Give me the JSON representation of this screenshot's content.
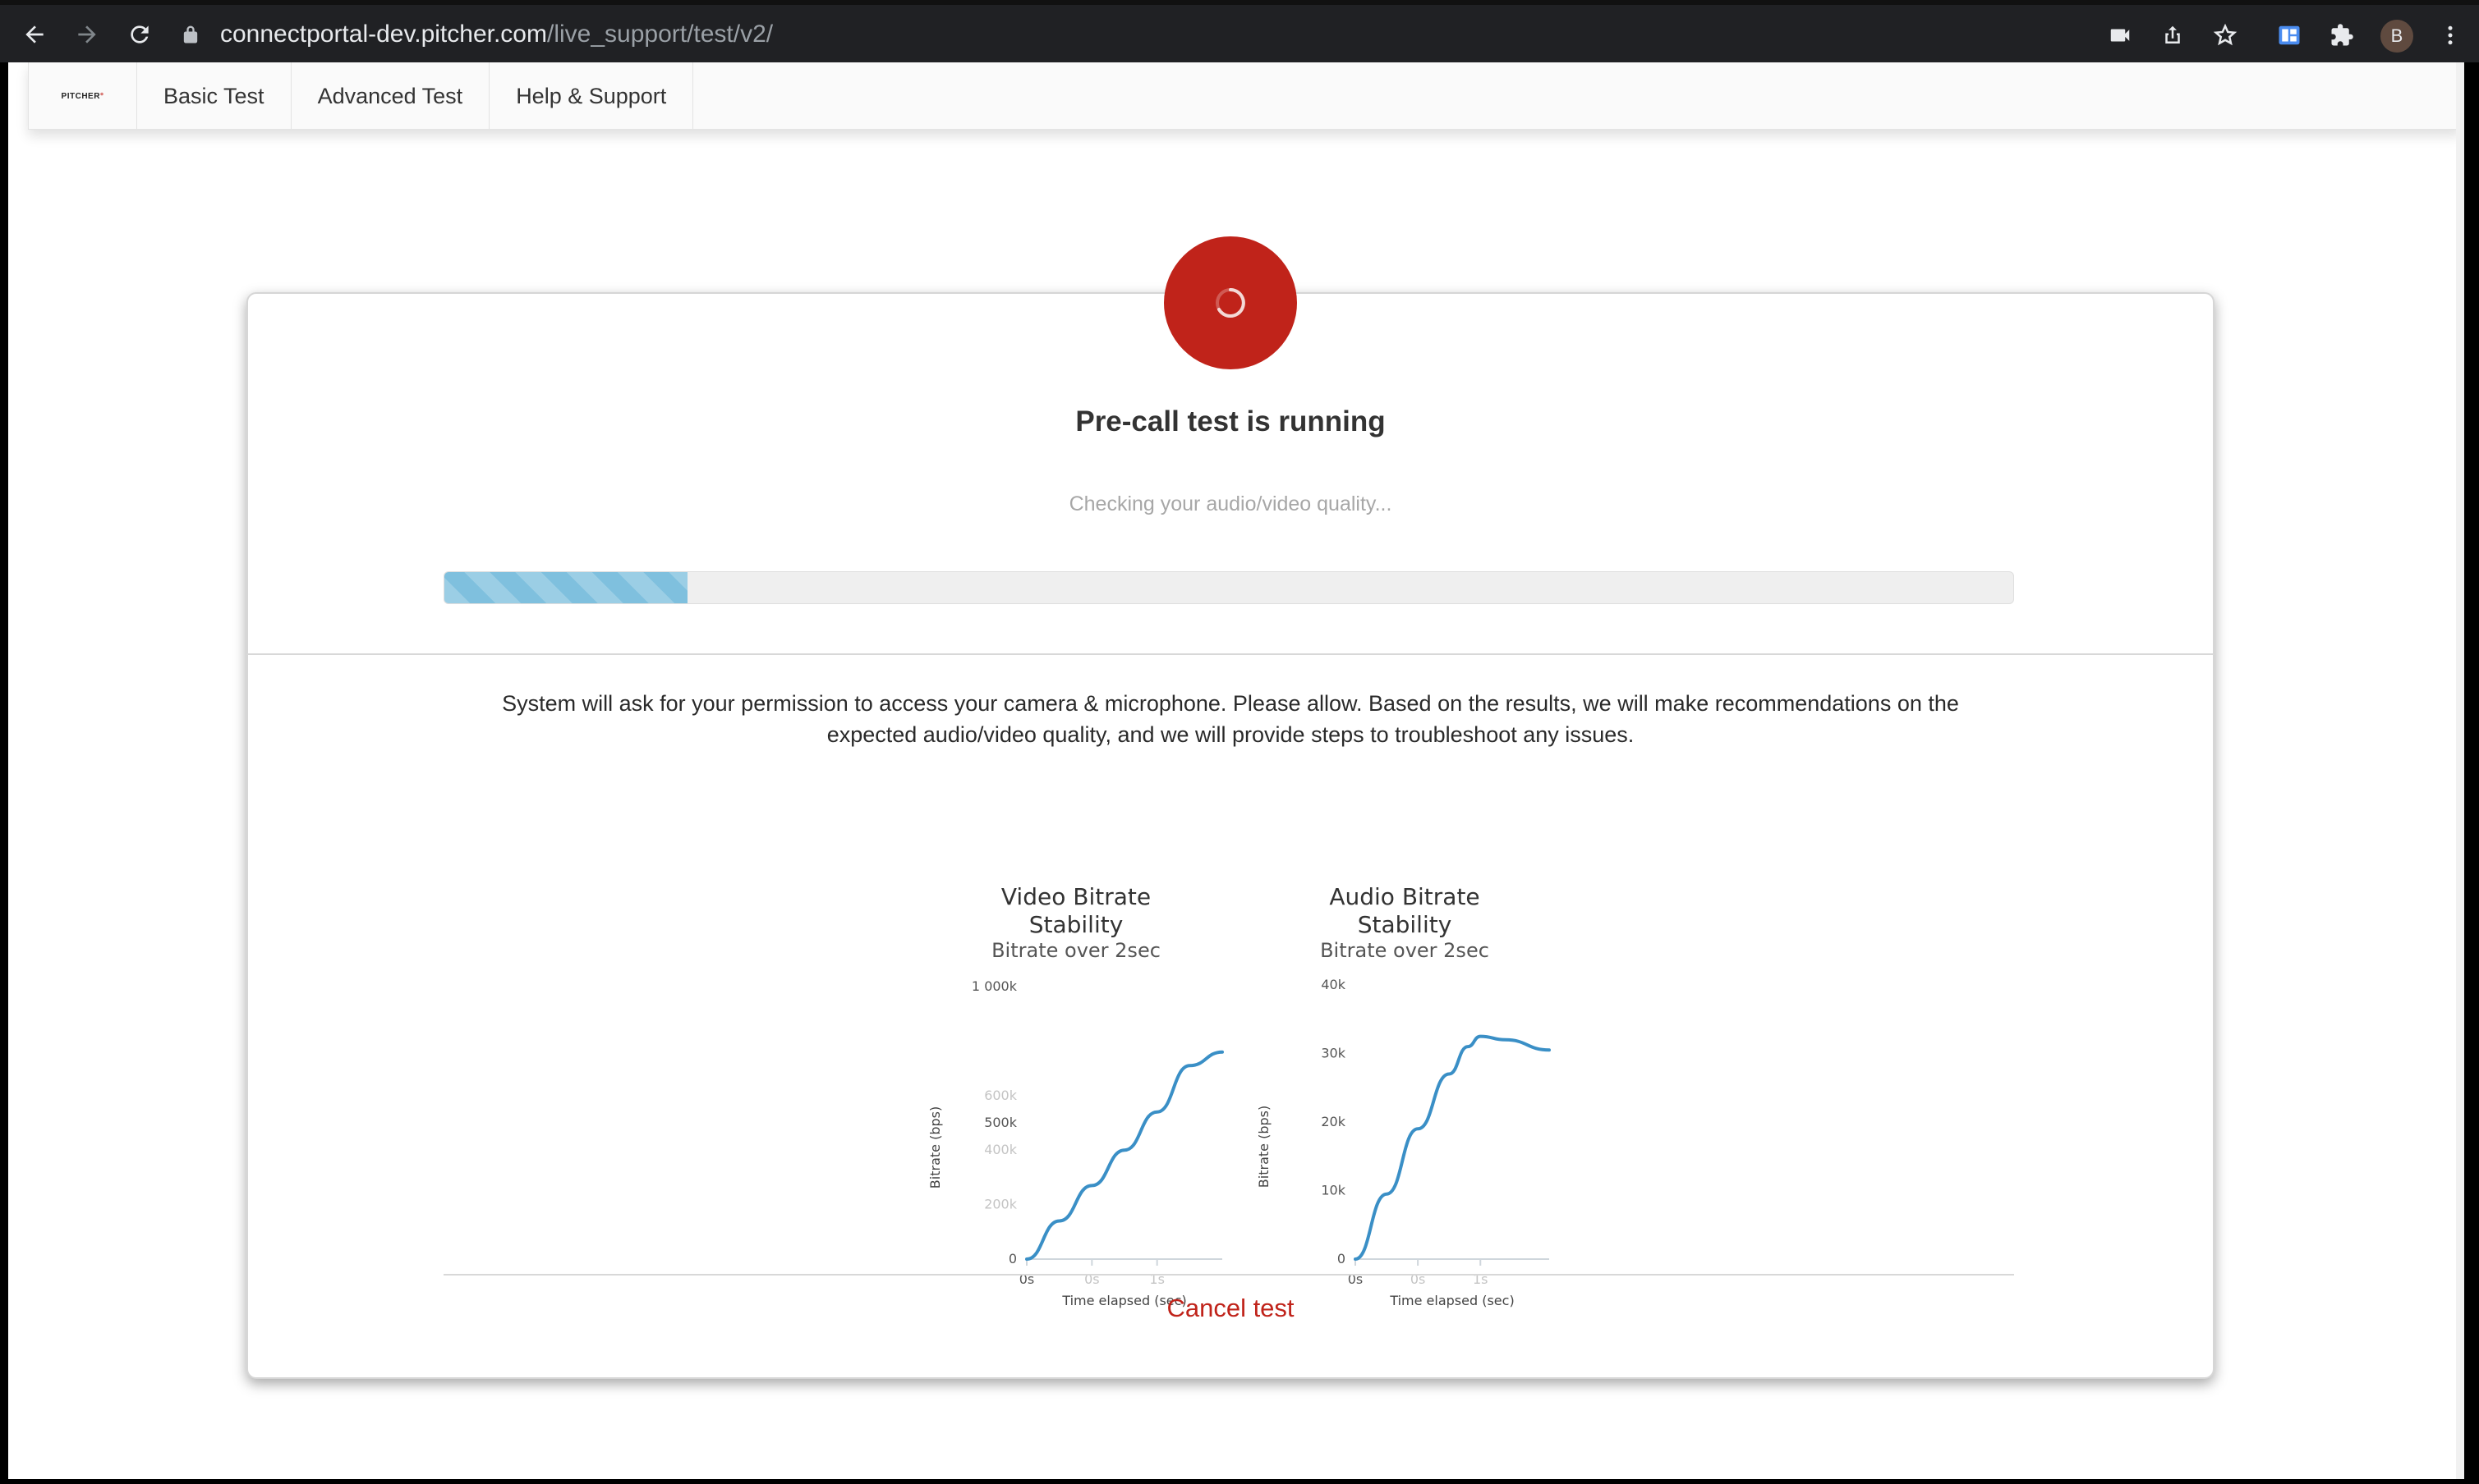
{
  "browser": {
    "url_host": "connectportal-dev.pitcher.com",
    "url_path": "/live_support/test/v2/",
    "profile_initial": "B"
  },
  "nav": {
    "logo_text": "PITCHER",
    "tabs": [
      "Basic Test",
      "Advanced Test",
      "Help & Support"
    ]
  },
  "status": {
    "title": "Pre-call test is running",
    "subtitle": "Checking your audio/video quality...",
    "progress_fraction": 0.155,
    "accent_color": "#c0231a",
    "progress_color": "#7fc0de"
  },
  "info_text": "System will ask for your permission to access your camera & microphone. Please allow. Based on the results, we will make recommendations on the expected audio/video quality, and we will provide steps to troubleshoot any issues.",
  "cancel_label": "Cancel test",
  "chart_data": [
    {
      "type": "line",
      "title": "Video Bitrate Stability",
      "subtitle": "Bitrate over 2sec",
      "xlabel": "Time elapsed (sec)",
      "ylabel": "Bitrate (bps)",
      "ylim": [
        0,
        1000000
      ],
      "y_ticks": [
        {
          "value": 0,
          "label": "0",
          "faint": false
        },
        {
          "value": 200000,
          "label": "200k",
          "faint": true
        },
        {
          "value": 400000,
          "label": "400k",
          "faint": true
        },
        {
          "value": 500000,
          "label": "500k",
          "faint": false
        },
        {
          "value": 600000,
          "label": "600k",
          "faint": true
        },
        {
          "value": 1000000,
          "label": "1 000k",
          "faint": false
        }
      ],
      "xlim": [
        0,
        1.5
      ],
      "x_ticks": [
        {
          "value": 0,
          "label": "0s",
          "faint": false
        },
        {
          "value": 0.5,
          "label": "0s",
          "faint": true
        },
        {
          "value": 1.0,
          "label": "1s",
          "faint": true
        }
      ],
      "series": [
        {
          "color": "#3a8fc6",
          "x": [
            0,
            0.25,
            0.5,
            0.75,
            1.0,
            1.25,
            1.5
          ],
          "y": [
            0,
            140000,
            270000,
            400000,
            540000,
            710000,
            760000
          ]
        }
      ]
    },
    {
      "type": "line",
      "title": "Audio Bitrate Stability",
      "subtitle": "Bitrate over 2sec",
      "xlabel": "Time elapsed (sec)",
      "ylabel": "Bitrate (bps)",
      "ylim": [
        0,
        40000
      ],
      "y_ticks": [
        {
          "value": 0,
          "label": "0",
          "faint": false
        },
        {
          "value": 10000,
          "label": "10k",
          "faint": false
        },
        {
          "value": 20000,
          "label": "20k",
          "faint": false
        },
        {
          "value": 30000,
          "label": "30k",
          "faint": false
        },
        {
          "value": 40000,
          "label": "40k",
          "faint": false
        }
      ],
      "xlim": [
        0,
        1.55
      ],
      "x_ticks": [
        {
          "value": 0,
          "label": "0s",
          "faint": false
        },
        {
          "value": 0.5,
          "label": "0s",
          "faint": true
        },
        {
          "value": 1.0,
          "label": "1s",
          "faint": true
        }
      ],
      "series": [
        {
          "color": "#3a8fc6",
          "x": [
            0,
            0.25,
            0.5,
            0.75,
            0.9,
            1.0,
            1.2,
            1.55
          ],
          "y": [
            0,
            9500,
            19000,
            27000,
            31000,
            32500,
            32000,
            30500
          ]
        }
      ]
    }
  ]
}
